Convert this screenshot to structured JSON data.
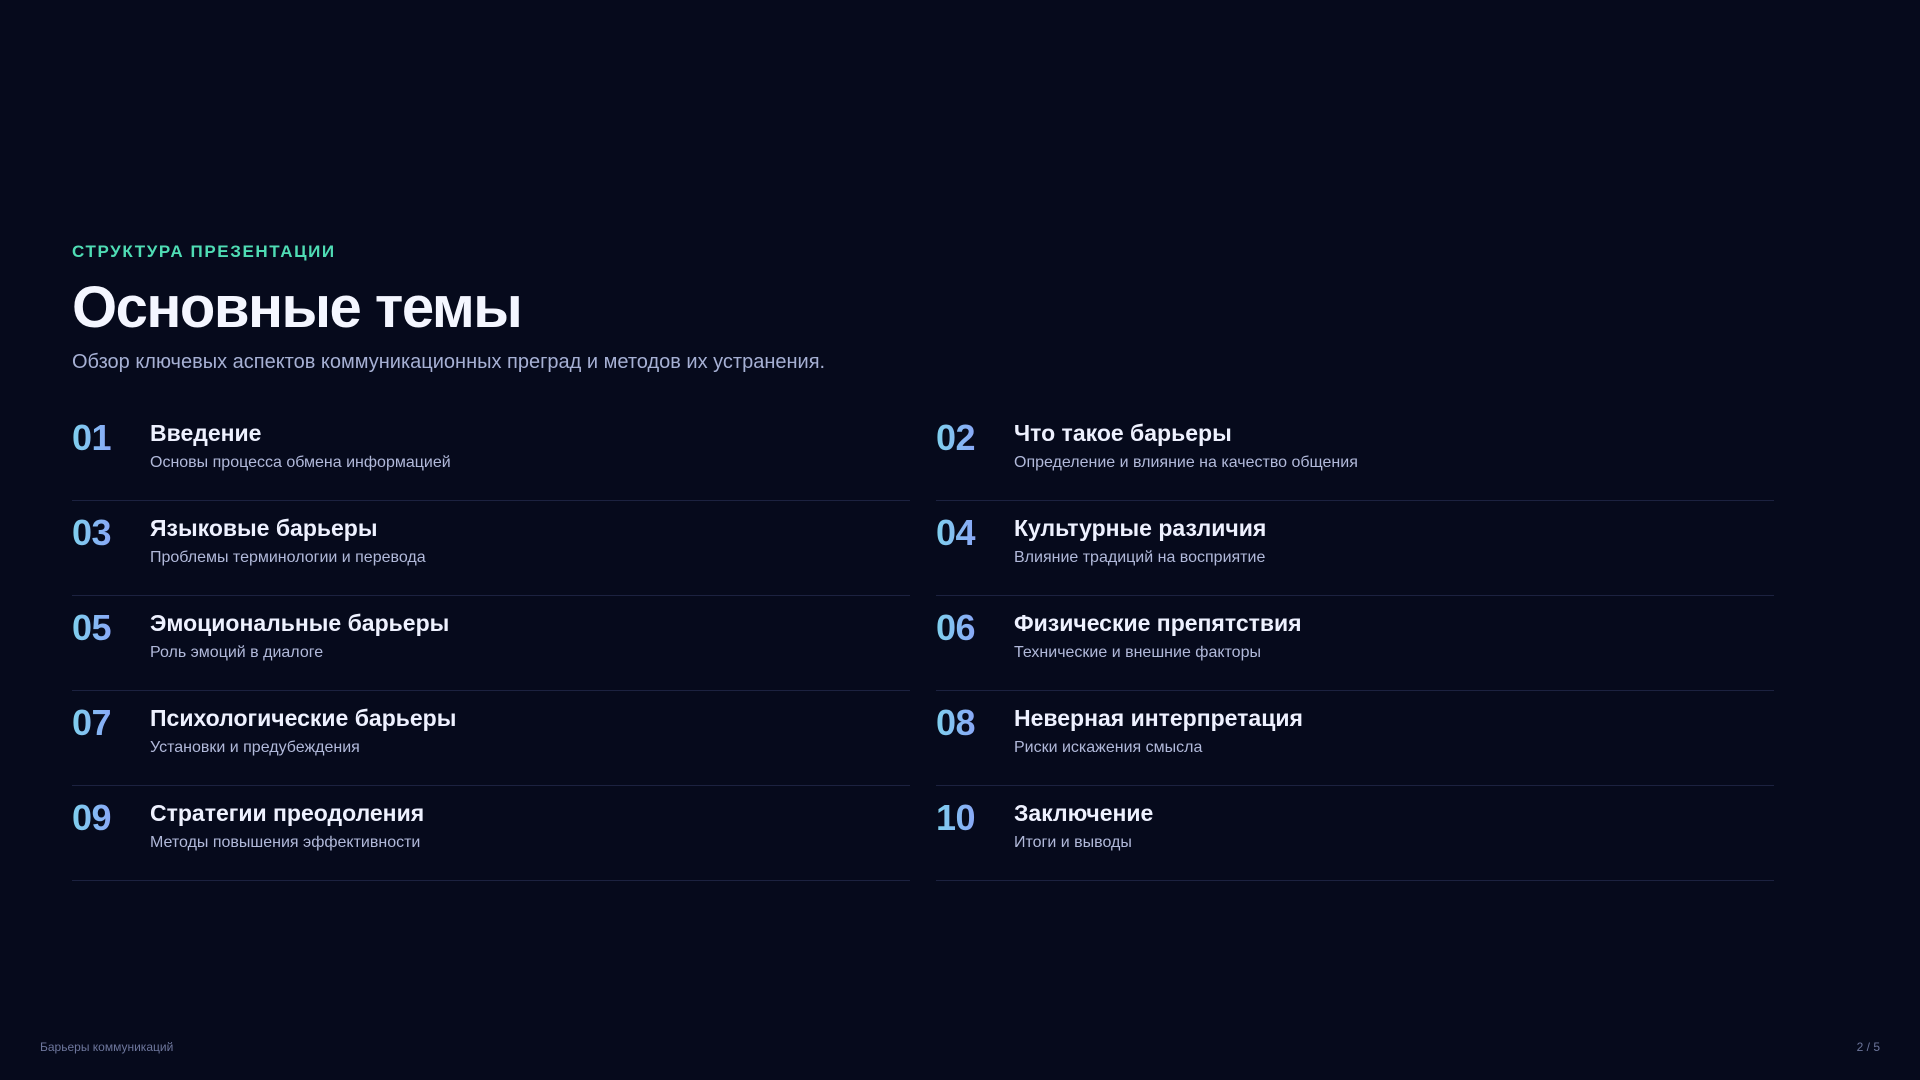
{
  "slide": {
    "eyebrow": "СТРУКТУРА ПРЕЗЕНТАЦИИ",
    "title": "Основные темы",
    "subtitle": "Обзор ключевых аспектов коммуникационных преград и методов их устранения.",
    "items": [
      {
        "num": "01",
        "title": "Введение",
        "desc": "Основы процесса обмена информацией"
      },
      {
        "num": "02",
        "title": "Что такое барьеры",
        "desc": "Определение и влияние на качество общения"
      },
      {
        "num": "03",
        "title": "Языковые барьеры",
        "desc": "Проблемы терминологии и перевода"
      },
      {
        "num": "04",
        "title": "Культурные различия",
        "desc": "Влияние традиций на восприятие"
      },
      {
        "num": "05",
        "title": "Эмоциональные барьеры",
        "desc": "Роль эмоций в диалоге"
      },
      {
        "num": "06",
        "title": "Физические препятствия",
        "desc": "Технические и внешние факторы"
      },
      {
        "num": "07",
        "title": "Психологические барьеры",
        "desc": "Установки и предубеждения"
      },
      {
        "num": "08",
        "title": "Неверная интерпретация",
        "desc": "Риски искажения смысла"
      },
      {
        "num": "09",
        "title": "Стратегии преодоления",
        "desc": "Методы повышения эффективности"
      },
      {
        "num": "10",
        "title": "Заключение",
        "desc": "Итоги и выводы"
      }
    ]
  },
  "footer": {
    "deck_title": "Барьеры коммуникаций",
    "page": "2 / 5"
  },
  "colors": {
    "background": "#060a1c",
    "accent_eyebrow": "#4fdcb4",
    "number_gradient": [
      "#7fd0ee",
      "#8aa4f8",
      "#a48cf6"
    ],
    "title": "#f4f6ff",
    "muted": "#a6b0d4",
    "divider": "#1c2240"
  }
}
